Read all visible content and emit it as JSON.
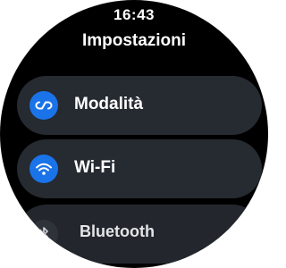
{
  "status": {
    "time": "16:43"
  },
  "header": {
    "title": "Impostazioni"
  },
  "settings": {
    "items": [
      {
        "label": "Modalità",
        "icon": "modes-icon",
        "icon_bg": "#1a73e8"
      },
      {
        "label": "Wi-Fi",
        "icon": "wifi-icon",
        "icon_bg": "#1a73e8"
      },
      {
        "label": "Bluetooth",
        "icon": "bluetooth-icon",
        "icon_bg": "#2e3239"
      }
    ]
  },
  "colors": {
    "background": "#000000",
    "chip": "#262a31",
    "accent": "#1a73e8",
    "text": "#ffffff"
  }
}
